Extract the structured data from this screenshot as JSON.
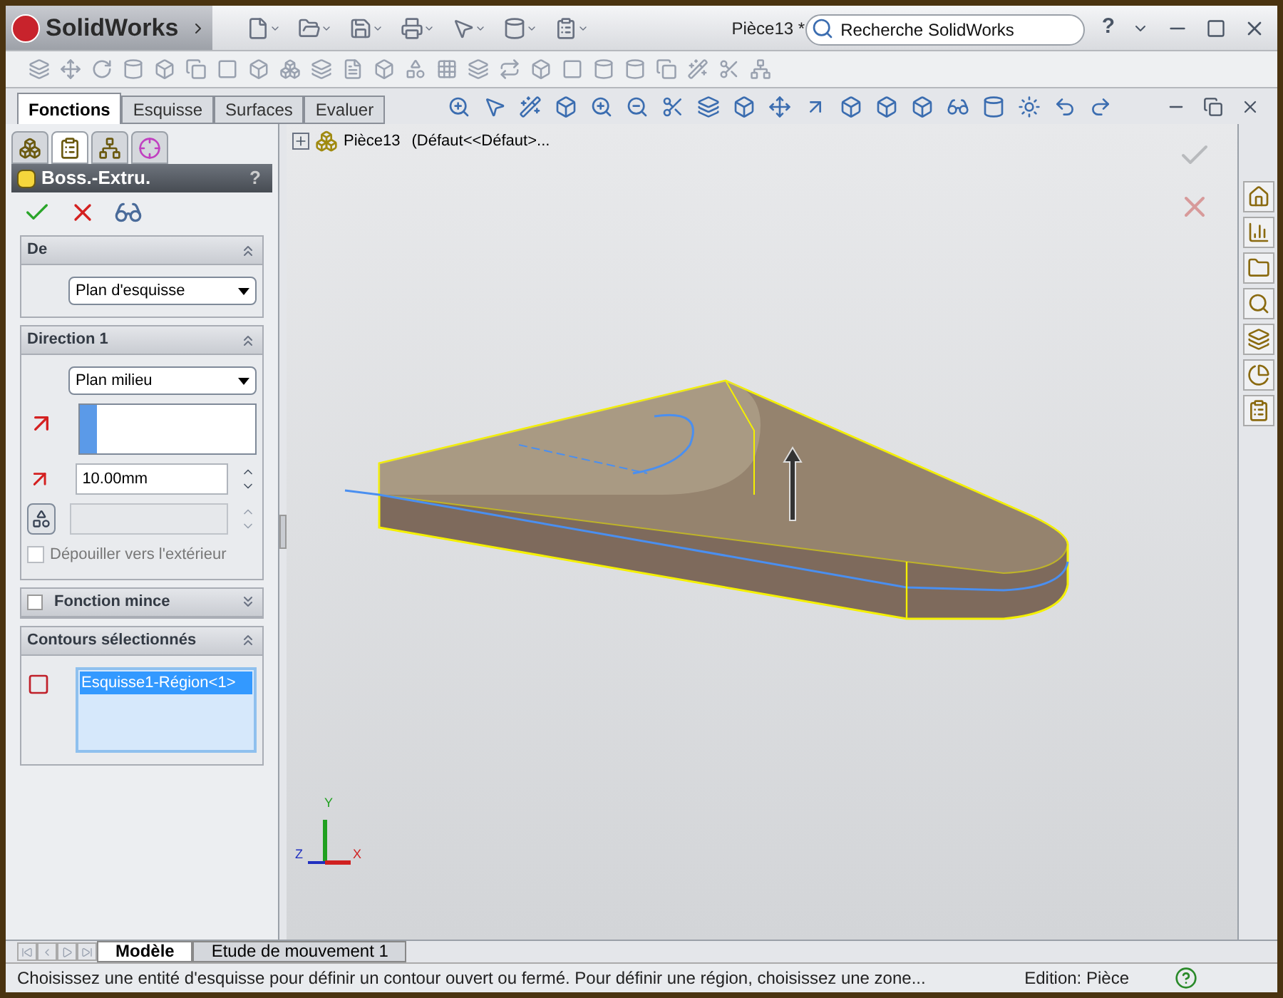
{
  "window": {
    "app_name": "SolidWorks",
    "title": "Pièce13 *"
  },
  "search": {
    "placeholder": "Recherche SolidWorks"
  },
  "help_menu": "?",
  "tabs": [
    {
      "label": "Fonctions",
      "selected": true
    },
    {
      "label": "Esquisse",
      "selected": false
    },
    {
      "label": "Surfaces",
      "selected": false
    },
    {
      "label": "Evaluer",
      "selected": false
    }
  ],
  "panel_tabs": [
    {
      "kind": "tree",
      "selected": false
    },
    {
      "kind": "properties",
      "selected": true
    },
    {
      "kind": "config",
      "selected": false
    },
    {
      "kind": "dimxpert",
      "selected": false
    }
  ],
  "feature_tree": {
    "root": "Pièce13",
    "config": "(Défaut<<Défaut>..."
  },
  "property_manager": {
    "title": "Boss.-Extru.",
    "help": "?",
    "from": {
      "title": "De",
      "expanded": true,
      "value": "Plan d'esquisse"
    },
    "direction": {
      "title": "Direction 1",
      "expanded": true,
      "value": "Plan milieu",
      "distance": "10.00mm",
      "draft": {
        "label": "Dépouiller vers l'extérieur",
        "checked": false
      }
    },
    "thin": {
      "title": "Fonction mince",
      "checked": false,
      "expanded": false
    },
    "contours": {
      "title": "Contours sélectionnés",
      "expanded": true,
      "items": [
        {
          "label": "Esquisse1-Région<1>",
          "selected": true
        }
      ]
    }
  },
  "triad": {
    "x": "X",
    "y": "Y",
    "z": "Z"
  },
  "bottom_tabs": [
    {
      "label": "Modèle",
      "selected": true
    },
    {
      "label": "Etude de mouvement 1",
      "selected": false
    }
  ],
  "status_bar": {
    "message": "Choisissez une entité d'esquisse pour définir un contour ouvert ou fermé. Pour définir une région, choisissez une zone...",
    "mode": "Edition: Pièce"
  }
}
